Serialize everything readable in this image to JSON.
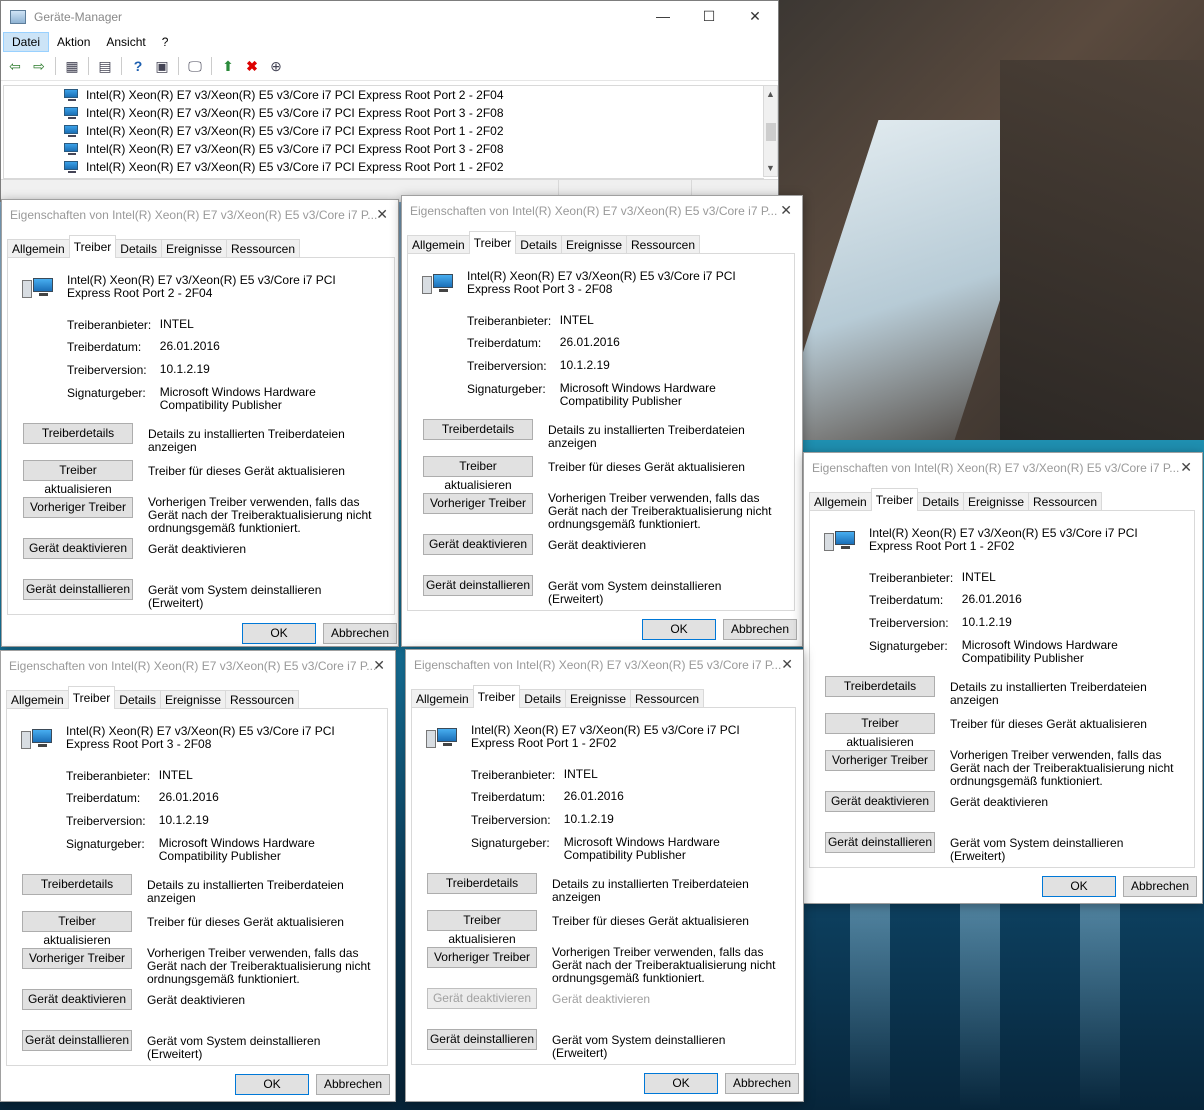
{
  "device_manager": {
    "title": "Geräte-Manager",
    "menus": [
      "Datei",
      "Aktion",
      "Ansicht",
      "?"
    ],
    "caption": {
      "minimize": "—",
      "maximize": "☐",
      "close": "✕"
    },
    "tree_items": [
      "Intel(R) Xeon(R) E7 v3/Xeon(R) E5 v3/Core i7 PCI Express Root Port 2 - 2F04",
      "Intel(R) Xeon(R) E7 v3/Xeon(R) E5 v3/Core i7 PCI Express Root Port 3 - 2F08",
      "Intel(R) Xeon(R) E7 v3/Xeon(R) E5 v3/Core i7 PCI Express Root Port 1 - 2F02",
      "Intel(R) Xeon(R) E7 v3/Xeon(R) E5 v3/Core i7 PCI Express Root Port 3 - 2F08",
      "Intel(R) Xeon(R) E7 v3/Xeon(R) E5 v3/Core i7 PCI Express Root Port 1 - 2F02"
    ],
    "toolbar_icons": [
      "back-icon",
      "forward-icon",
      "properties-icon",
      "grid-icon",
      "help-icon",
      "view-icon",
      "monitor-icon",
      "update-driver-icon",
      "uninstall-icon",
      "download-icon"
    ]
  },
  "common": {
    "title": "Eigenschaften von Intel(R) Xeon(R) E7 v3/Xeon(R) E5 v3/Core i7 P...",
    "tabs": [
      "Allgemein",
      "Treiber",
      "Details",
      "Ereignisse",
      "Ressourcen"
    ],
    "labels": {
      "provider": "Treiberanbieter:",
      "date": "Treiberdatum:",
      "version": "Treiberversion:",
      "signer": "Signaturgeber:"
    },
    "values": {
      "provider": "INTEL",
      "date": "26.01.2016",
      "version": "10.1.2.19",
      "signer": "Microsoft Windows Hardware Compatibility Publisher"
    },
    "buttons": {
      "details": "Treiberdetails",
      "update": "Treiber aktualisieren",
      "rollback": "Vorheriger Treiber",
      "disable": "Gerät deaktivieren",
      "uninstall": "Gerät deinstallieren",
      "ok": "OK",
      "cancel": "Abbrechen"
    },
    "descriptions": {
      "details": "Details zu installierten Treiberdateien anzeigen",
      "update": "Treiber für dieses Gerät aktualisieren",
      "rollback": "Vorherigen Treiber verwenden, falls das Gerät nach der Treiberaktualisierung nicht ordnungsgemäß funktioniert.",
      "disable": "Gerät deaktivieren",
      "uninstall": "Gerät vom System deinstallieren (Erweitert)"
    }
  },
  "dialogs": [
    {
      "device": "Intel(R) Xeon(R) E7 v3/Xeon(R) E5 v3/Core i7 PCI Express Root Port 2 - 2F04",
      "disable_enabled": true
    },
    {
      "device": "Intel(R) Xeon(R) E7 v3/Xeon(R) E5 v3/Core i7 PCI Express Root Port 3 - 2F08",
      "disable_enabled": true
    },
    {
      "device": "Intel(R) Xeon(R) E7 v3/Xeon(R) E5 v3/Core i7 PCI Express Root Port 1 - 2F02",
      "disable_enabled": true
    },
    {
      "device": "Intel(R) Xeon(R) E7 v3/Xeon(R) E5 v3/Core i7 PCI Express Root Port 3 - 2F08",
      "disable_enabled": true
    },
    {
      "device": "Intel(R) Xeon(R) E7 v3/Xeon(R) E5 v3/Core i7 PCI Express Root Port 1 - 2F02",
      "disable_enabled": false
    }
  ]
}
